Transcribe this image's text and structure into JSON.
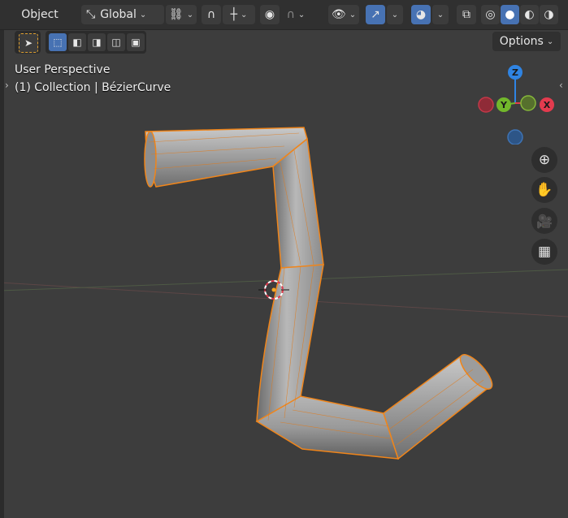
{
  "header": {
    "mode_label": "Object",
    "transform_orientation": "Global",
    "options_label": "Options"
  },
  "viewport": {
    "view_name": "User Perspective",
    "collection_info": "(1) Collection | BézierCurve"
  },
  "gizmo": {
    "x_label": "X",
    "y_label": "Y",
    "z_label": "Z"
  },
  "icons": {
    "transform": "transform-orientation-icon",
    "snap": "snap-magnet-icon",
    "proportional": "proportional-editing-icon",
    "visibility": "visibility-eye-icon",
    "gizmo": "gizmo-toggle-icon",
    "overlay": "overlay-toggle-icon",
    "xray": "xray-toggle-icon",
    "zoom": "zoom-icon",
    "pan": "hand-pan-icon",
    "camera": "camera-view-icon",
    "ortho": "perspective-grid-icon"
  },
  "colors": {
    "selection_outline": "#f0851a",
    "active_blue": "#4772b3",
    "axis_x": "#e33b4e",
    "axis_y": "#72b82b",
    "axis_z": "#2f84e3"
  }
}
